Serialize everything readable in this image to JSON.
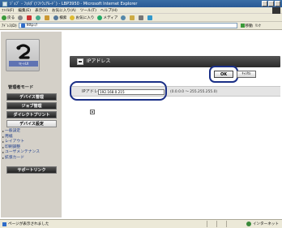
{
  "window": {
    "title": "ｼﾞｮﾌﾞ - ﾌｫﾙﾀﾞ(ｿﾌﾄｳｪｱﾓｰﾄﾞ) - LBP3950 - Microsoft Internet Explorer"
  },
  "menu": {
    "items": [
      "ﾌｧｲﾙ(F)",
      "編集(E)",
      "表示(V)",
      "お気に入り(A)",
      "ツール(T)",
      "ヘルプ(H)"
    ]
  },
  "toolbar": {
    "back": "戻る",
    "search": "検索",
    "favorites": "お気に入り",
    "media": "メディア"
  },
  "address": {
    "label": "ｱﾄﾞﾚｽ(D)",
    "value": "http://",
    "go": "移動",
    "links": "ﾘﾝｸ"
  },
  "sidebar": {
    "logo_caption": "ﾘﾓｰﾄUI",
    "mode": "管理者モード",
    "buttons": [
      {
        "label": "デバイス管理",
        "style": "dark"
      },
      {
        "label": "ジョブ管理",
        "style": "dark"
      },
      {
        "label": "ダイレクトプリント",
        "style": "dark"
      },
      {
        "label": "デバイス設定",
        "style": "light"
      }
    ],
    "submenu": [
      "一般設定",
      "用紙",
      "レイアウト",
      "印刷調整",
      "ユーザメンテナンス",
      "拡張カード"
    ],
    "support": "サポートリンク"
  },
  "panel": {
    "title": "IPアドレス",
    "ok": "OK",
    "cancel": "ｷｬﾝｾﾙ",
    "ip_label": "IPアドレス：",
    "ip_value": "192.168.0.215",
    "ip_range": "(0.0.0.0 ～ 255.255.255.0)"
  },
  "statusbar": {
    "message": "ページが表示されました",
    "zone": "インターネット"
  },
  "colors": {
    "highlight_ring": "#1a2f86",
    "header_dark": "#2a2a2a"
  }
}
